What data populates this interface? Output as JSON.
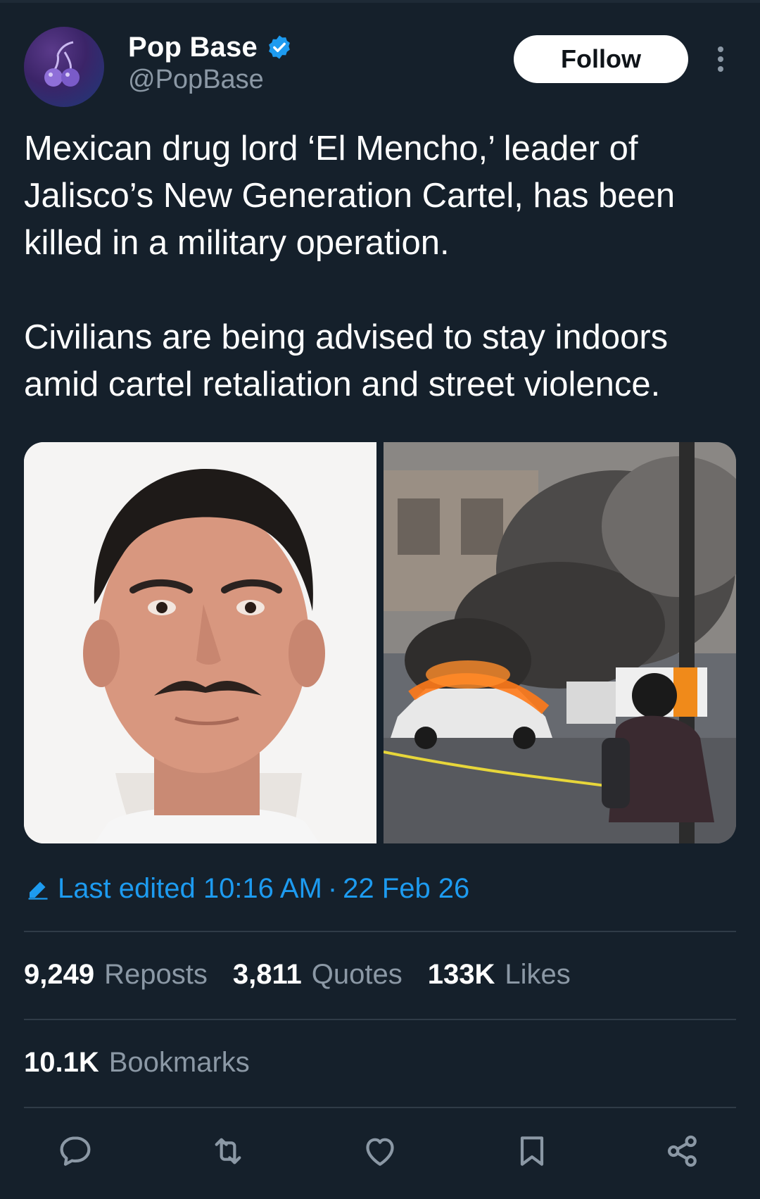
{
  "author": {
    "display_name": "Pop Base",
    "handle": "@PopBase",
    "verified": true,
    "avatar_icon": "cherry-icon"
  },
  "follow_label": "Follow",
  "tweet": {
    "paragraph1": "Mexican drug lord ‘El Mencho,’ leader of Jalisco’s New Generation Cartel, has been killed in a military operation.",
    "paragraph2": "Civilians are being advised to stay indoors amid cartel retaliation and street violence."
  },
  "media": [
    {
      "alt_name": "mugshot-photo"
    },
    {
      "alt_name": "burning-car-photo"
    }
  ],
  "edited": {
    "label": "Last edited 10:16 AM",
    "separator": "·",
    "date": "22 Feb 26"
  },
  "stats": {
    "reposts_count": "9,249",
    "reposts_label": "Reposts",
    "quotes_count": "3,811",
    "quotes_label": "Quotes",
    "likes_count": "133K",
    "likes_label": "Likes",
    "bookmarks_count": "10.1K",
    "bookmarks_label": "Bookmarks"
  },
  "actions": [
    "reply-icon",
    "repost-icon",
    "like-icon",
    "bookmark-icon",
    "share-icon"
  ],
  "colors": {
    "background": "#15202b",
    "accent": "#1d9bf0",
    "muted": "#8b98a5",
    "divider": "#2f3b47"
  }
}
